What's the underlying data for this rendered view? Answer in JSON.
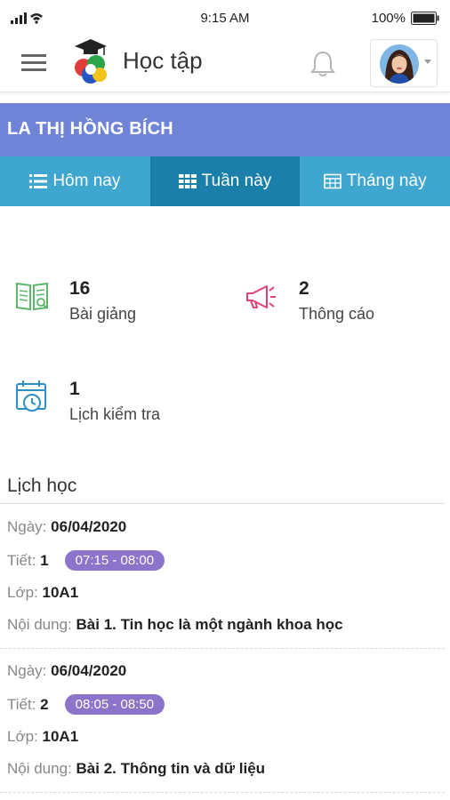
{
  "status_bar": {
    "time": "9:15 AM",
    "battery": "100%"
  },
  "app_bar": {
    "title": "Học tập"
  },
  "student": {
    "name": "LA THỊ HỒNG BÍCH"
  },
  "tabs": [
    {
      "label": "Hôm nay",
      "icon": "list-icon"
    },
    {
      "label": "Tuần này",
      "icon": "grid-icon"
    },
    {
      "label": "Tháng này",
      "icon": "calendar-icon"
    }
  ],
  "active_tab": "Tuần này",
  "stats": {
    "lessons": {
      "value": "16",
      "label": "Bài giảng"
    },
    "announcements": {
      "value": "2",
      "label": "Thông cáo"
    },
    "tests": {
      "value": "1",
      "label": "Lịch kiểm tra"
    }
  },
  "schedule": {
    "title": "Lịch học",
    "labels": {
      "date": "Ngày:",
      "period": "Tiết:",
      "class": "Lớp:",
      "content": "Nội dung:"
    },
    "entries": [
      {
        "date": "06/04/2020",
        "period": "1",
        "time": "07:15 - 08:00",
        "class": "10A1",
        "content": "Bài 1. Tin học là một ngành khoa học"
      },
      {
        "date": "06/04/2020",
        "period": "2",
        "time": "08:05 - 08:50",
        "class": "10A1",
        "content": "Bài 2. Thông tin và dữ liệu"
      }
    ]
  },
  "colors": {
    "name_bar": "#6f84d6",
    "tabs": "#3fa6cf",
    "active_tab": "#1a7fa9",
    "pill": "#8b74c9",
    "lesson_icon": "#5db56a",
    "announce_icon": "#e0407a",
    "test_icon": "#2d8fc7"
  }
}
